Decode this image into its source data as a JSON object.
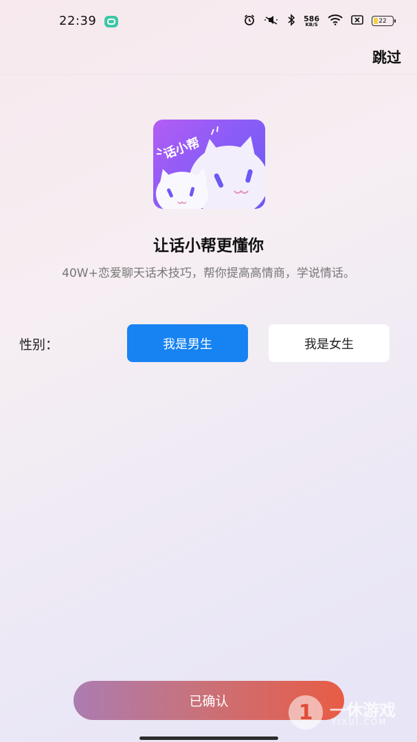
{
  "status_bar": {
    "time": "22:39",
    "net_speed_value": "586",
    "net_speed_unit": "KB/S",
    "battery_level": "22"
  },
  "header": {
    "skip_label": "跳过"
  },
  "logo": {
    "text": "话小帮"
  },
  "intro": {
    "title": "让话小帮更懂你",
    "subtitle": "40W+恋爱聊天话术技巧，帮你提高高情商，学说情话。"
  },
  "gender": {
    "label": "性别：",
    "male_label": "我是男生",
    "female_label": "我是女生",
    "selected": "male"
  },
  "confirm": {
    "label": "已确认"
  },
  "watermark": {
    "glyph": "1",
    "text": "一休游戏",
    "sub": "YIXUI.COM"
  },
  "colors": {
    "primary_blue": "#1783f2",
    "confirm_gradient_start": "#ab7cb1",
    "confirm_gradient_end": "#e85c45",
    "logo_purple": "#8c5cf7"
  }
}
